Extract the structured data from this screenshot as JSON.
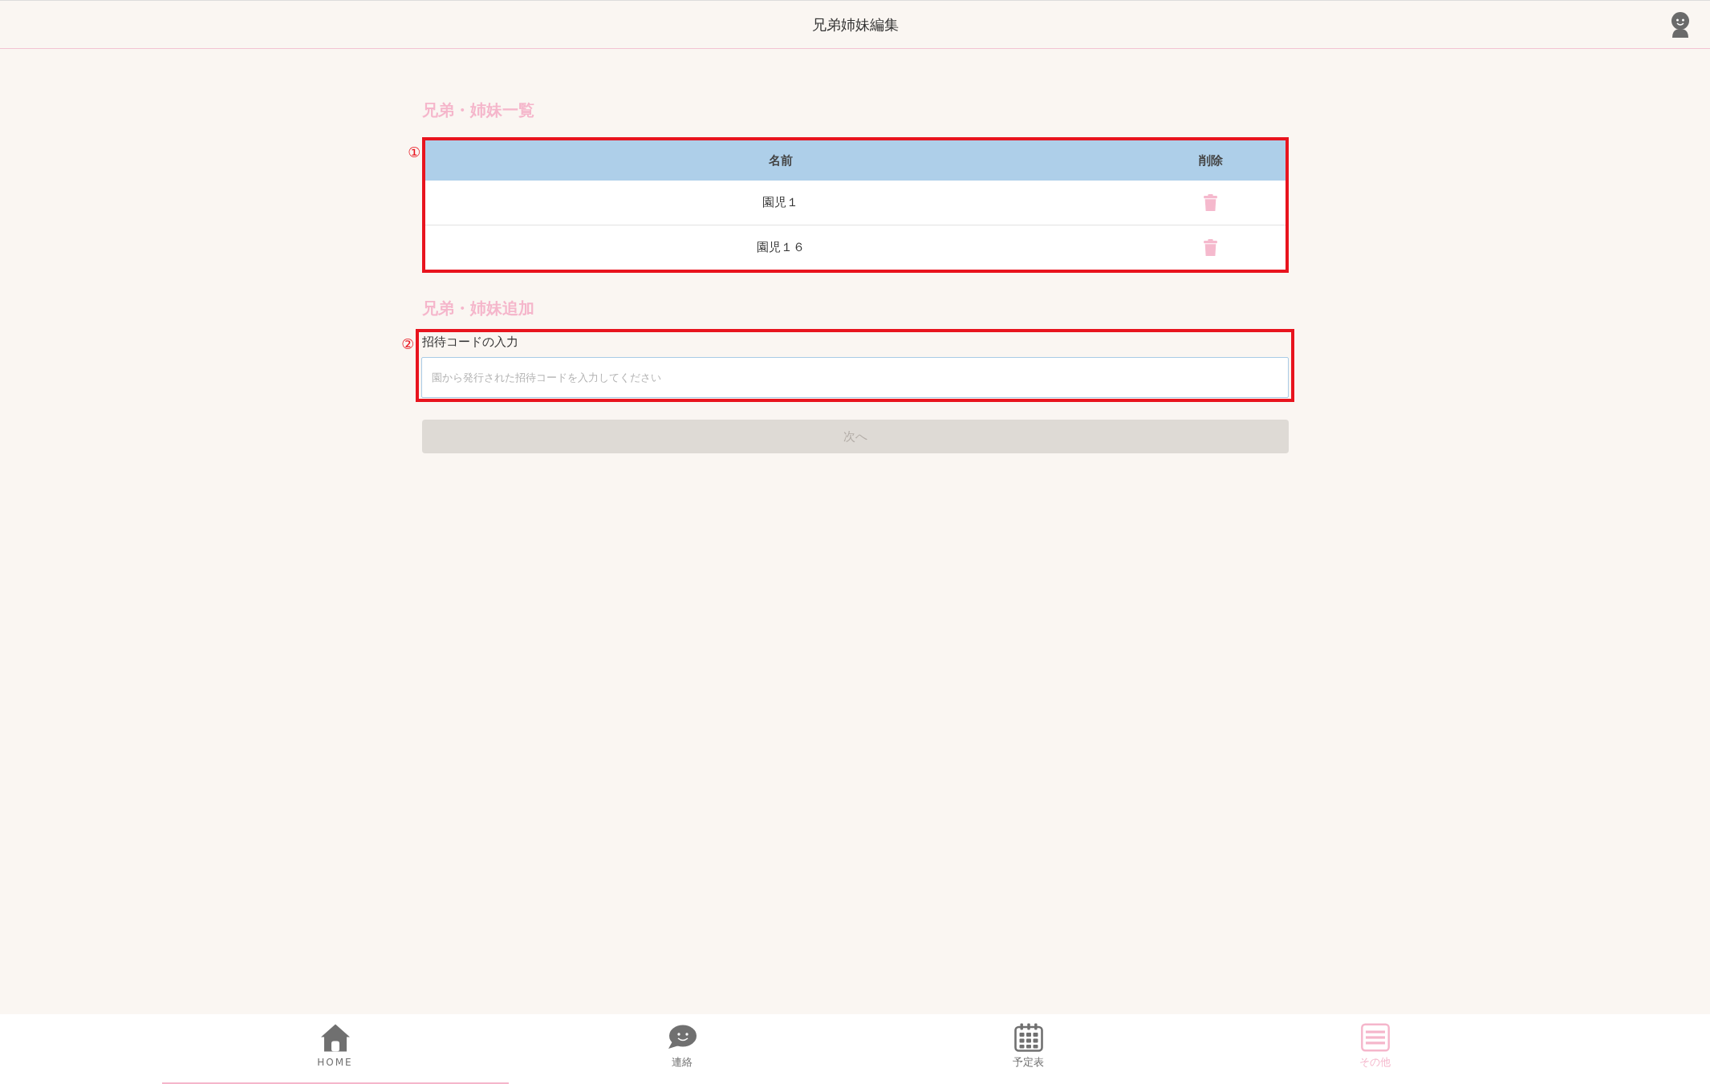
{
  "header": {
    "title": "兄弟姉妹編集"
  },
  "sections": [
    {
      "kind": "table",
      "title": "兄弟・姉妹一覧",
      "annotation": "①",
      "table": {
        "columns": [
          "名前",
          "削除"
        ],
        "rows": [
          {
            "name": "園児１"
          },
          {
            "name": "園児１６"
          }
        ]
      }
    },
    {
      "kind": "form",
      "title": "兄弟・姉妹追加",
      "annotation": "②",
      "field": {
        "label": "招待コードの入力",
        "placeholder": "園から発行された招待コードを入力してください"
      },
      "button": {
        "label": "次へ",
        "disabled": true
      }
    }
  ],
  "bottom_nav": {
    "items": [
      {
        "kind": "home",
        "label": "HOME",
        "selected": false,
        "focused": true
      },
      {
        "kind": "chat",
        "label": "連絡",
        "selected": false,
        "focused": false
      },
      {
        "kind": "calendar",
        "label": "予定表",
        "selected": false,
        "focused": false
      },
      {
        "kind": "menu",
        "label": "その他",
        "selected": true,
        "focused": false
      }
    ]
  }
}
